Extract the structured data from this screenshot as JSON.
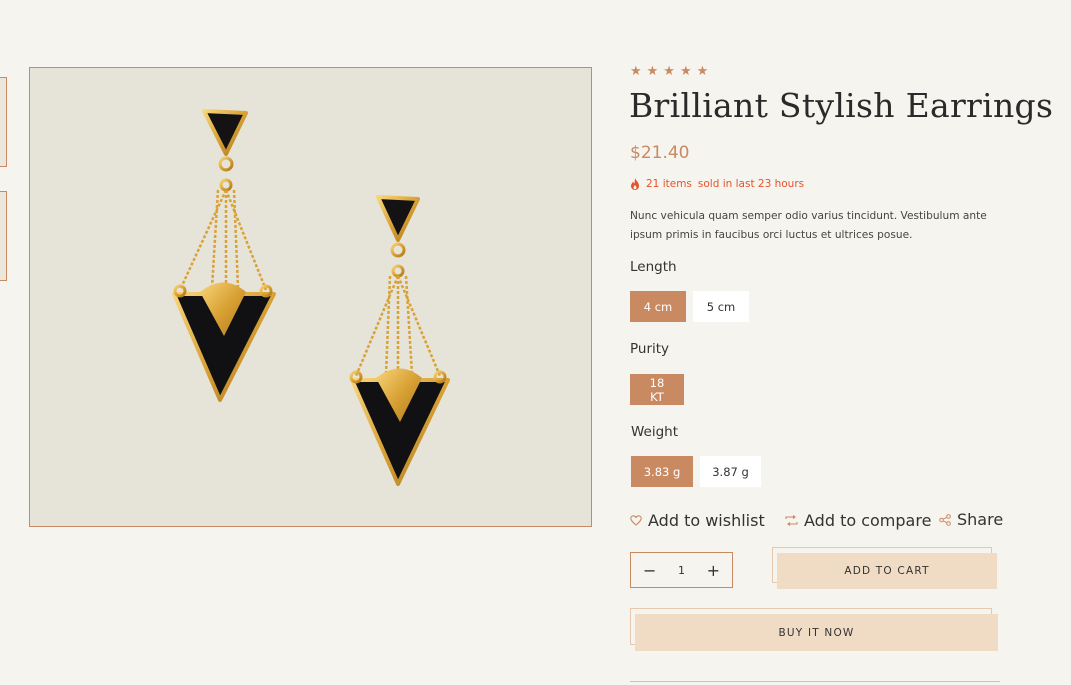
{
  "product": {
    "rating_stars": "★★★★★",
    "title": "Brilliant Stylish Earrings",
    "price": "$21.40",
    "sold_count": "21 items",
    "sold_text": "sold in last 23 hours",
    "description": "Nunc vehicula quam semper odio varius tincidunt. Vestibulum ante ipsum primis in faucibus orci luctus et ultrices posue."
  },
  "options": {
    "length": {
      "label": "Length",
      "values": [
        "4 cm",
        "5 cm"
      ],
      "selected": "4 cm"
    },
    "purity": {
      "label": "Purity",
      "values": [
        "18 KT"
      ],
      "selected": "18 KT"
    },
    "weight": {
      "label": "Weight",
      "values": [
        "3.83 g",
        "3.87 g"
      ],
      "selected": "3.83 g"
    }
  },
  "actions": {
    "wishlist": "Add to wishlist",
    "compare": "Add to compare",
    "share": "Share"
  },
  "cart": {
    "quantity": "1",
    "minus_symbol": "−",
    "plus_symbol": "+",
    "add_to_cart": "ADD TO CART",
    "buy_now": "BUY IT NOW"
  },
  "colors": {
    "accent": "#c98a62",
    "hot": "#e5532b",
    "button_bg": "#f0dcc4",
    "image_bg": "#e6e3d9"
  }
}
